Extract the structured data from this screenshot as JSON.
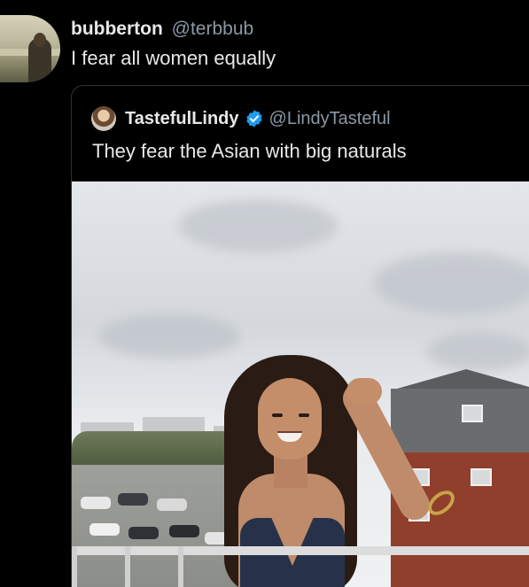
{
  "outer_tweet": {
    "display_name": "bubberton",
    "handle": "@terbbub",
    "text": "I fear all women equally"
  },
  "quoted_tweet": {
    "display_name": "TastefulLindy",
    "handle": "@LindyTasteful",
    "verified": true,
    "text": "They fear the Asian with big naturals",
    "media": "photo"
  },
  "colors": {
    "background": "#000000",
    "primary_text": "#e7e9ea",
    "secondary_text": "#8b98a5",
    "verified_badge": "#1d9bf0",
    "card_border": "#2f3336"
  },
  "icons": {
    "verified": "verified-badge-icon"
  }
}
